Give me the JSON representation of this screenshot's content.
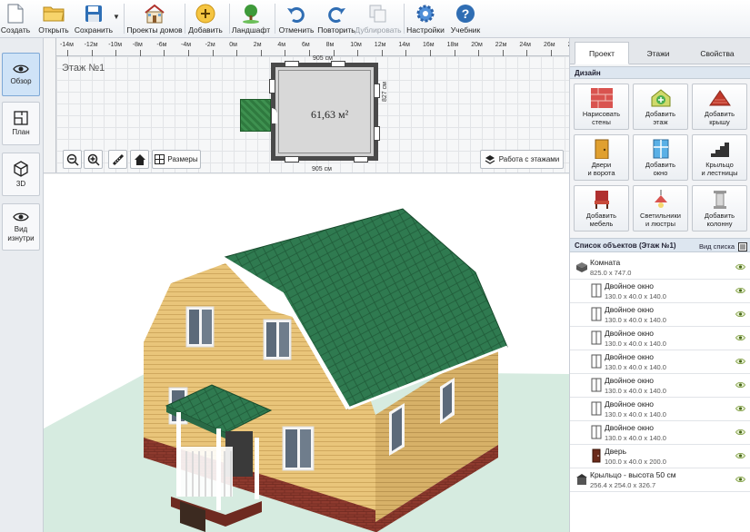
{
  "toolbar": {
    "create": "Создать",
    "open": "Открыть",
    "save": "Сохранить",
    "projects": "Проекты домов",
    "add": "Добавить",
    "landscape": "Ландшафт",
    "undo": "Отменить",
    "redo": "Повторить",
    "duplicate": "Дублировать",
    "settings": "Настройки",
    "tutorial": "Учебник"
  },
  "leftnav": {
    "overview": "Обзор",
    "plan": "План",
    "view3d": "3D",
    "inside": "Вид\nизнутри"
  },
  "plan": {
    "floor_label": "Этаж №1",
    "room_area": "61,63 м²",
    "dim_vertical": "827 см",
    "dim_horizontal": "905 см",
    "dim_top": "905 см",
    "ruler_labels": [
      "-14м",
      "-12м",
      "-10м",
      "-8м",
      "-6м",
      "-4м",
      "-2м",
      "0м",
      "2м",
      "4м",
      "6м",
      "8м",
      "10м",
      "12м",
      "14м",
      "16м",
      "18м",
      "20м",
      "22м",
      "24м",
      "26м",
      "28м"
    ],
    "sizes_btn": "Размеры",
    "floors_btn": "Работа с этажами"
  },
  "rpanel": {
    "tabs": [
      "Проект",
      "Этажи",
      "Свойства"
    ],
    "design_header": "Дизайн",
    "design_buttons": [
      "Нарисовать\nстены",
      "Добавить\nэтаж",
      "Добавить\nкрышу",
      "Двери\nи ворота",
      "Добавить\nокно",
      "Крыльцо\nи лестницы",
      "Добавить\nмебель",
      "Светильники\nи люстры",
      "Добавить\nколонну"
    ],
    "objects_header": "Список объектов (Этаж №1)",
    "list_view": "Вид списка",
    "objects": [
      {
        "name": "Комната",
        "dims": "825.0 x 747.0"
      },
      {
        "name": "Двойное окно",
        "dims": "130.0 x 40.0 x 140.0"
      },
      {
        "name": "Двойное окно",
        "dims": "130.0 x 40.0 x 140.0"
      },
      {
        "name": "Двойное окно",
        "dims": "130.0 x 40.0 x 140.0"
      },
      {
        "name": "Двойное окно",
        "dims": "130.0 x 40.0 x 140.0"
      },
      {
        "name": "Двойное окно",
        "dims": "130.0 x 40.0 x 140.0"
      },
      {
        "name": "Двойное окно",
        "dims": "130.0 x 40.0 x 140.0"
      },
      {
        "name": "Двойное окно",
        "dims": "130.0 x 40.0 x 140.0"
      },
      {
        "name": "Дверь",
        "dims": "100.0 x 40.0 x 200.0"
      },
      {
        "name": "Крыльцо - высота 50 см",
        "dims": "256.4 x 254.0 x 326.7"
      }
    ]
  },
  "colors": {
    "accent": "#cfe3f7",
    "roof": "#2f7a50",
    "walls": "#e8c67a",
    "ground": "#cfe8dc"
  }
}
